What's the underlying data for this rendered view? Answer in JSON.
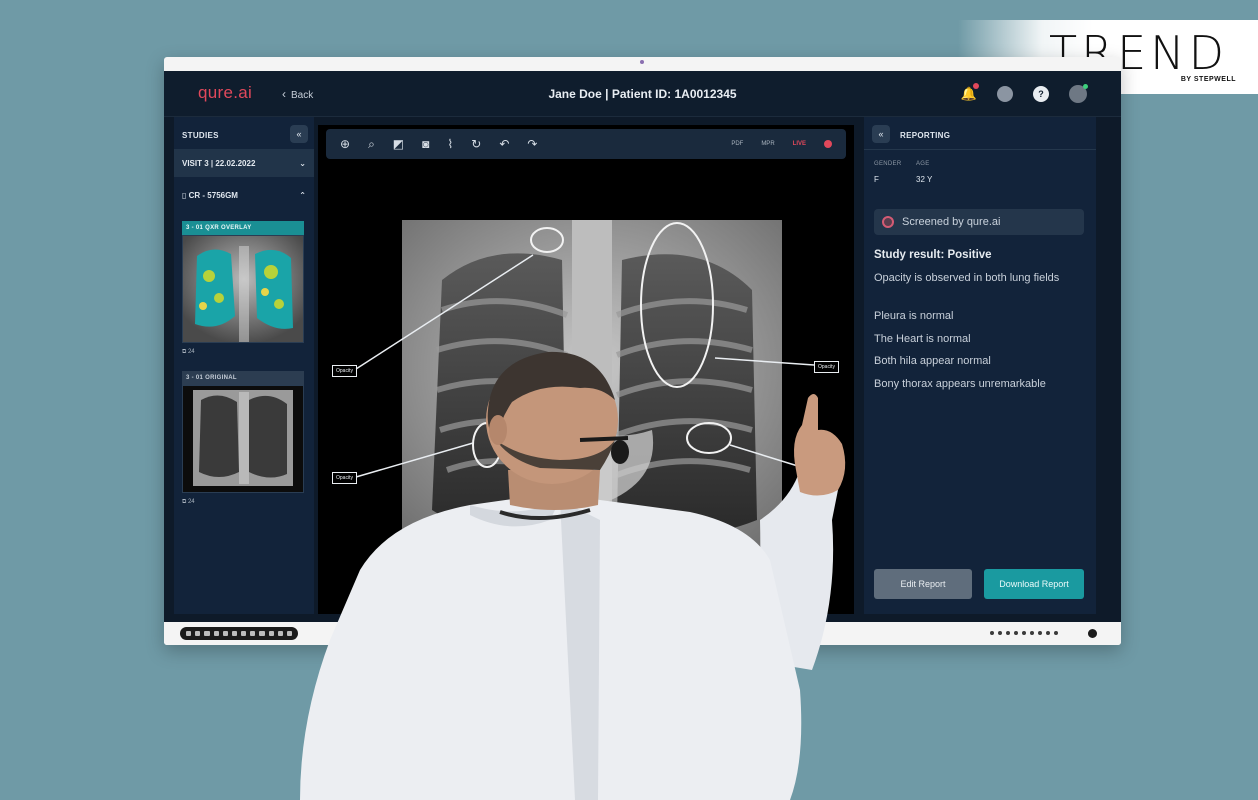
{
  "brand": {
    "name": "TREND",
    "subtitle": "BY STEPWELL"
  },
  "app": {
    "logo": "qure.ai",
    "back_label": "Back",
    "patient_title": "Jane Doe | Patient ID: 1A0012345"
  },
  "header_icons": [
    "bell-icon",
    "globe-icon",
    "help-icon",
    "user-avatar"
  ],
  "studies": {
    "header": "STUDIES",
    "visit": "VISIT 3 | 22.02.2022",
    "series": "CR - 5756GM",
    "thumbnails": [
      {
        "label": "3 - 01  QXR OVERLAY",
        "count": "24"
      },
      {
        "label": "3 - 01  ORIGINAL",
        "count": "24"
      }
    ]
  },
  "viewer": {
    "toolbar_right": [
      "PDF",
      "MPR",
      "LIVE"
    ],
    "annotations": [
      "Opacity",
      "Opacity",
      "Opacity"
    ]
  },
  "reporting": {
    "header": "REPORTING",
    "gender_label": "GENDER",
    "gender_value": "F",
    "age_label": "AGE",
    "age_value": "32 Y",
    "screened_by": "Screened by qure.ai",
    "study_result": "Study result: Positive",
    "findings": [
      "Opacity is observed in both lung fields",
      "Pleura is normal",
      "The Heart is normal",
      "Both hila appear normal",
      "Bony thorax appears unremarkable"
    ],
    "edit_button": "Edit Report",
    "download_button": "Download Report"
  },
  "colors": {
    "background": "#6f9aa6",
    "app_bg": "#0e1a29",
    "accent_teal": "#1a9aa0",
    "accent_red": "#e1485b"
  }
}
